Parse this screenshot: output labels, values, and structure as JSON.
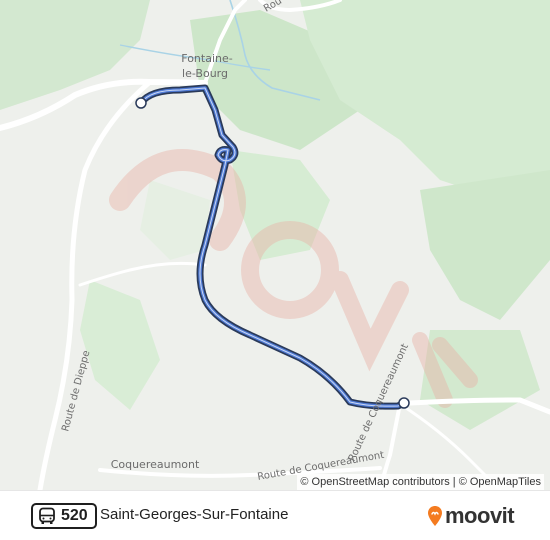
{
  "map": {
    "places": {
      "fontaine_line1": "Fontaine-",
      "fontaine_line2": "le-Bourg",
      "coquereaumont": "Coquereaumont"
    },
    "roads": {
      "route_de_dieppe": "Route de Dieppe",
      "route_de_coquereaumont_south": "Route de Coquereaumont",
      "route_de_coquereaumont_vertical": "Route de Coquereaumont",
      "top_fragment": "Rou"
    },
    "route_line_color": "#4f7bd6",
    "route_line_outline": "#2a3a5a",
    "watermark_color": "#e9b3a8"
  },
  "attribution": "© OpenStreetMap contributors | © OpenMapTiles",
  "footer": {
    "route_number": "520",
    "route_name": "Saint-Georges-Sur-Fontaine",
    "brand": "moovit",
    "brand_color": "#f47b20",
    "bus_icon": "bus-icon"
  }
}
